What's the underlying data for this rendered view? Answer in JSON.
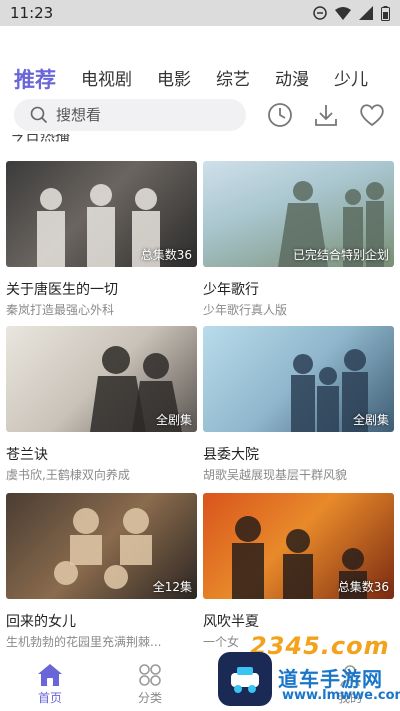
{
  "status": {
    "time": "11:23"
  },
  "tabs": [
    "推荐",
    "电视剧",
    "电影",
    "综艺",
    "动漫",
    "少儿"
  ],
  "search": {
    "placeholder": "搜想看"
  },
  "section": {
    "title_clipped": "今日热播"
  },
  "cards": [
    {
      "title": "关于唐医生的一切",
      "subtitle": "秦岚打造最强心外科",
      "badge": "总集数36",
      "bg": "linear-gradient(135deg,#3b3b3b 0%,#6b6560 45%,#2b2b2b 100%)",
      "fig": "#e8e4de"
    },
    {
      "title": "少年歌行",
      "subtitle": "少年歌行真人版",
      "badge": "已完结合特别企划",
      "bg": "linear-gradient(160deg,#cfe0ea 0%,#a9c6cf 40%,#7a8f75 100%)",
      "fig": "#5c6b60"
    },
    {
      "title": "苍兰诀",
      "subtitle": "虞书欣,王鹤棣双向养成",
      "badge": "全剧集",
      "bg": "linear-gradient(135deg,#e9e6df 0%,#c9c2b8 50%,#5a5450 100%)",
      "fig": "#2d2a28"
    },
    {
      "title": "县委大院",
      "subtitle": "胡歌吴越展现基层干群风貌",
      "badge": "全剧集",
      "bg": "linear-gradient(135deg,#b9dcea 0%,#8fb6cc 50%,#3e5d74 100%)",
      "fig": "#2c3f55"
    },
    {
      "title": "回来的女儿",
      "subtitle": "生机勃勃的花园里充满荆棘...",
      "badge": "全12集",
      "bg": "linear-gradient(135deg,#4a3d33 0%,#8a6b4d 50%,#2c2622 100%)",
      "fig": "#e0c9a8"
    },
    {
      "title": "风吹半夏",
      "subtitle": "一个女",
      "badge": "总集数36",
      "bg": "linear-gradient(135deg,#d9541d 0%,#e88a2a 45%,#7a2a12 100%)",
      "fig": "#2a1e1a"
    }
  ],
  "nav": [
    {
      "label": "首页",
      "active": true
    },
    {
      "label": "分类",
      "active": false
    },
    {
      "label": "",
      "active": false
    },
    {
      "label": "我的",
      "active": false
    }
  ],
  "watermark": {
    "top": "2345.com",
    "cn": "道车手游网",
    "url": "www.lmwwe.com"
  },
  "colors": {
    "accent": "#6a66d8",
    "status_bar": "#dcdcdc",
    "search_bg": "#f1f1f4"
  }
}
